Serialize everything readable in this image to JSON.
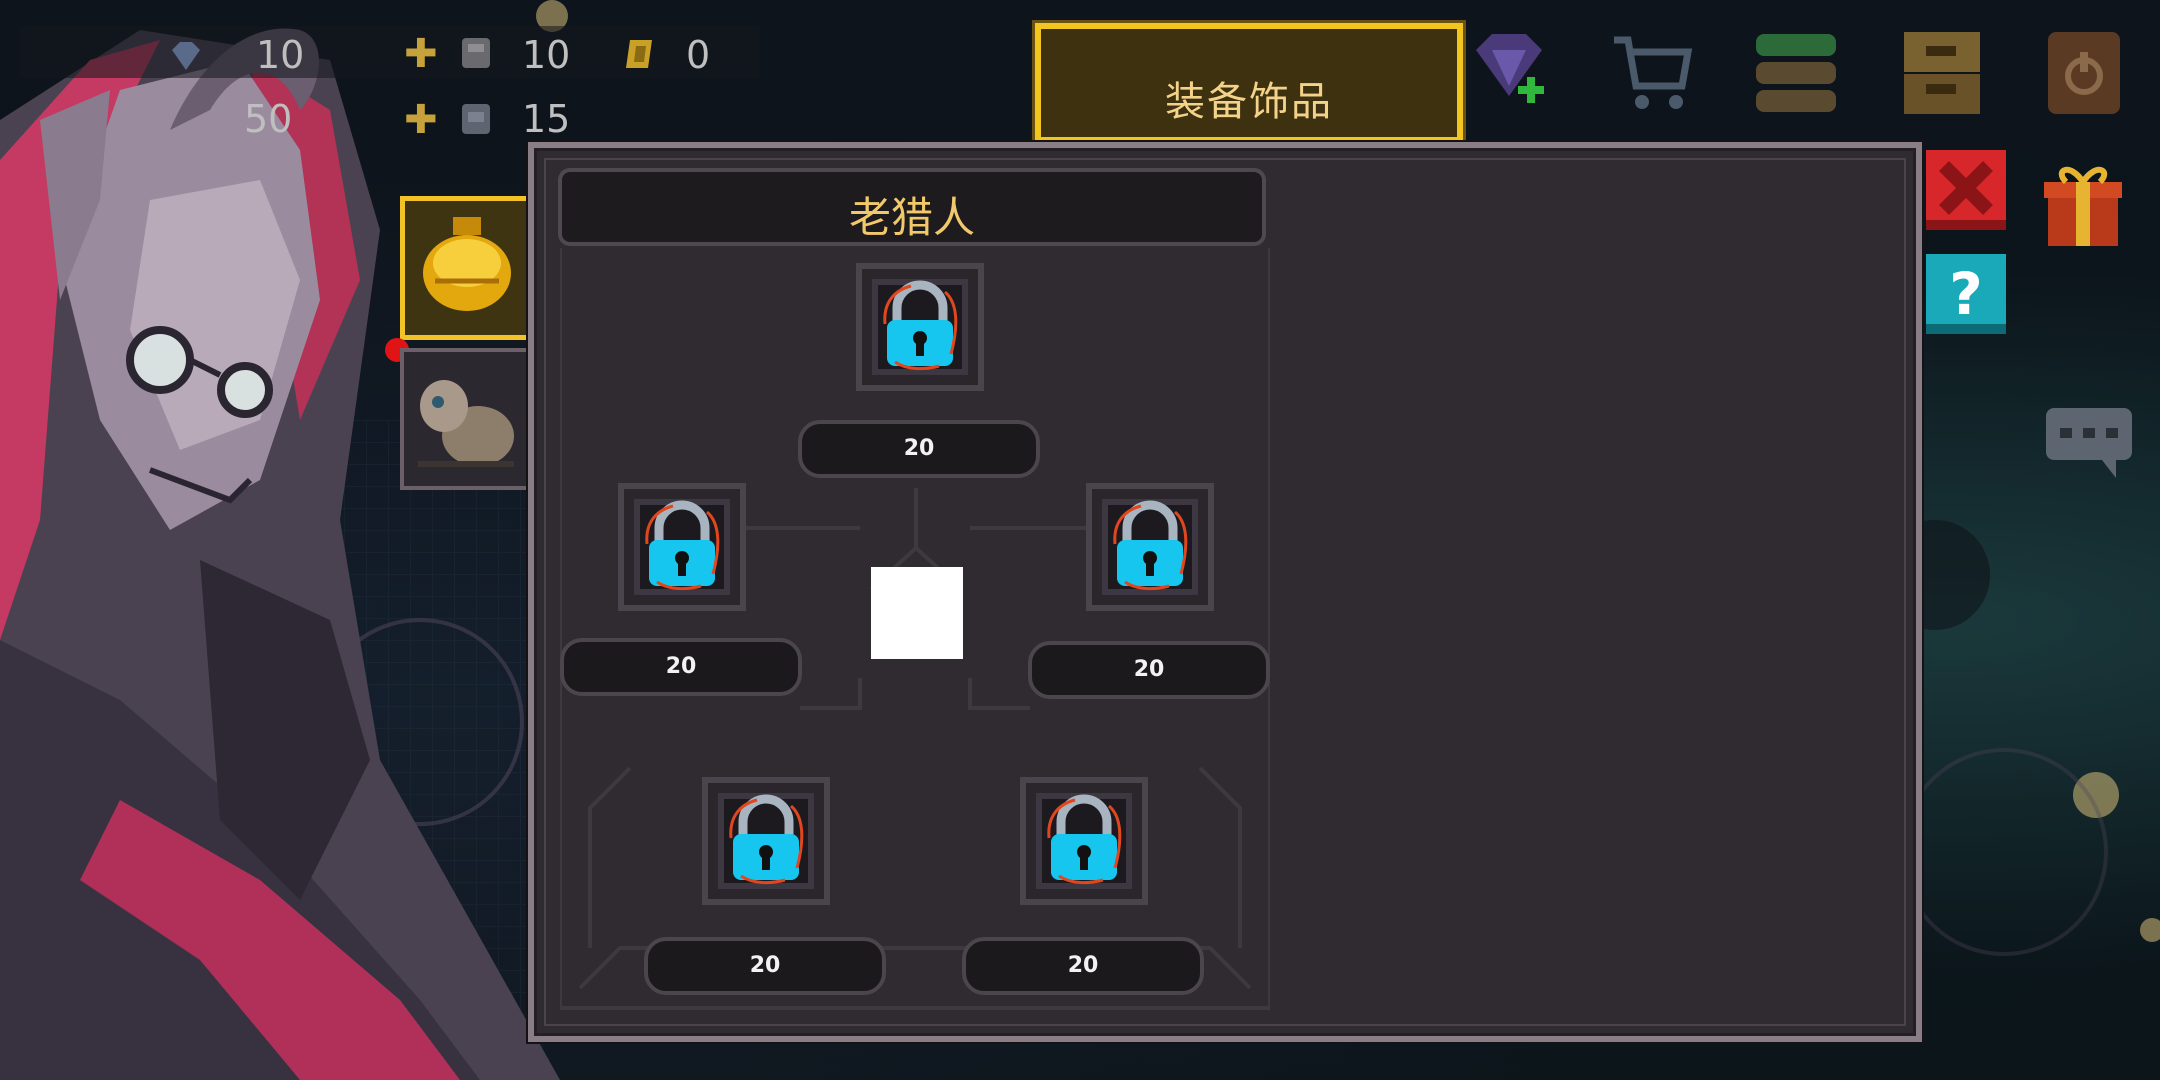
{
  "hud": {
    "gems_count": "10",
    "coins_count": "50",
    "material1_count": "10",
    "material2_count": "15",
    "ticket_count": "0"
  },
  "tabs": {
    "equip_accessory": "装备饰品"
  },
  "panel": {
    "character_name": "老猎人",
    "slots": [
      {
        "cost": "20",
        "state": "locked"
      },
      {
        "cost": "20",
        "state": "locked"
      },
      {
        "cost": "20",
        "state": "locked"
      },
      {
        "cost": "20",
        "state": "locked"
      },
      {
        "cost": "20",
        "state": "locked"
      }
    ]
  },
  "colors": {
    "accent_gold": "#f3c61f",
    "lock_cyan": "#17c6ee",
    "close_red": "#d8272a",
    "help_teal": "#1aa9b8"
  }
}
